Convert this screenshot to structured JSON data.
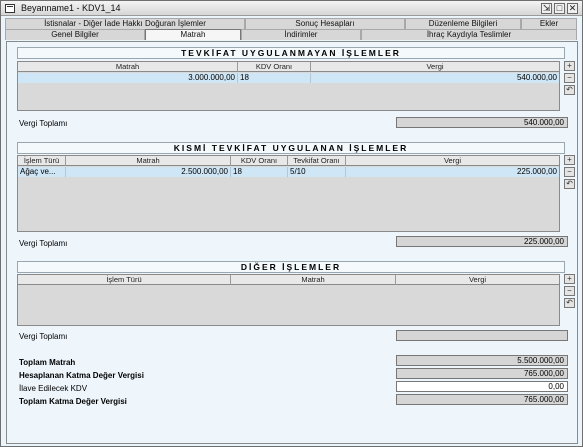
{
  "window": {
    "title": "Beyanname1 - KDV1_14"
  },
  "titlebar_buttons": {
    "restore": "⇲",
    "maximize": "□",
    "close": "✕"
  },
  "tabs_row1": [
    "İstisnalar - Diğer İade Hakkı Doğuran İşlemler",
    "Sonuç Hesapları",
    "Düzenleme Bilgileri",
    "Ekler"
  ],
  "tabs_row2": [
    "Genel Bilgiler",
    "Matrah",
    "İndirimler",
    "İhraç Kaydıyla Teslimler"
  ],
  "active_tab": "Matrah",
  "sections": {
    "s1": {
      "title": "TEVKİFAT UYGULANMAYAN İŞLEMLER",
      "columns": [
        "Matrah",
        "KDV Oranı",
        "Vergi"
      ],
      "rows": [
        [
          "3.000.000,00",
          "18",
          "540.000,00"
        ]
      ],
      "total_label": "Vergi Toplamı",
      "total_value": "540.000,00"
    },
    "s2": {
      "title": "KISMİ TEVKİFAT UYGULANAN İŞLEMLER",
      "columns": [
        "İşlem Türü",
        "Matrah",
        "KDV Oranı",
        "Tevkifat Oranı",
        "Vergi"
      ],
      "rows": [
        [
          "Ağaç ve...",
          "2.500.000,00",
          "18",
          "5/10",
          "225.000,00"
        ]
      ],
      "total_label": "Vergi Toplamı",
      "total_value": "225.000,00"
    },
    "s3": {
      "title": "DİĞER İŞLEMLER",
      "columns": [
        "İşlem Türü",
        "Matrah",
        "Vergi"
      ],
      "rows": [],
      "total_label": "Vergi Toplamı",
      "total_value": ""
    }
  },
  "summary": {
    "toplam_matrah_label": "Toplam Matrah",
    "toplam_matrah_value": "5.500.000,00",
    "hesaplanan_label": "Hesaplanan Katma Değer Vergisi",
    "hesaplanan_value": "765.000,00",
    "ilave_label": "İlave Edilecek KDV",
    "ilave_value": "0,00",
    "toplam_kdv_label": "Toplam Katma Değer Vergisi",
    "toplam_kdv_value": "765.000,00"
  },
  "side_buttons": {
    "add": "+",
    "remove": "−",
    "undo": "↶"
  }
}
